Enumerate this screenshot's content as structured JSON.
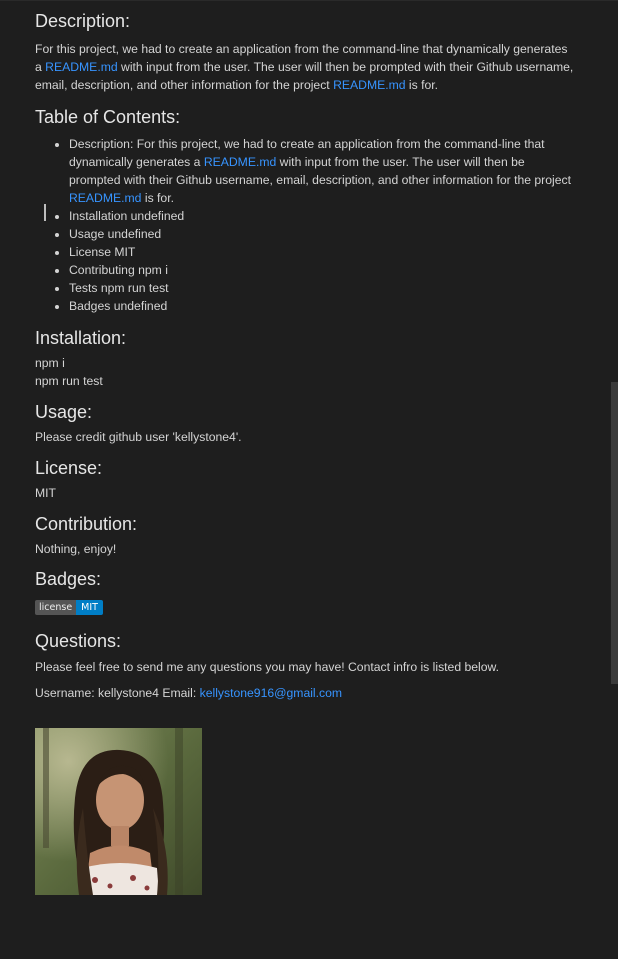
{
  "description": {
    "heading": "Description:",
    "text_before": "For this project, we had to create an application from the command-line that dynamically generates a ",
    "link1": "README.md",
    "text_middle": " with input from the user. The user will then be prompted with their Github username, email, description, and other information for the project ",
    "link2": "README.md",
    "text_after": " is for."
  },
  "toc": {
    "heading": "Table of Contents:",
    "desc_item": {
      "before": "Description: For this project, we had to create an application from the command-line that dynamically generates a ",
      "link1": "README.md",
      "middle": " with input from the user. The user will then be prompted with their Github username, email, description, and other information for the project ",
      "link2": "README.md",
      "after": " is for."
    },
    "items": [
      "Installation undefined",
      "Usage undefined",
      "License MIT",
      "Contributing npm i",
      "Tests npm run test",
      "Badges undefined"
    ]
  },
  "installation": {
    "heading": "Installation:",
    "line1": "npm i",
    "line2": "npm run test"
  },
  "usage": {
    "heading": "Usage:",
    "text": "Please credit github user 'kellystone4'."
  },
  "license": {
    "heading": "License:",
    "text": "MIT"
  },
  "contribution": {
    "heading": "Contribution:",
    "text": "Nothing, enjoy!"
  },
  "badges": {
    "heading": "Badges:",
    "badge_label": "license",
    "badge_value": "MIT",
    "badge_color": "#007ec6"
  },
  "questions": {
    "heading": "Questions:",
    "text": "Please feel free to send me any questions you may have! Contact infro is listed below.",
    "contact_prefix": "Username: kellystone4 Email: ",
    "email": "kellystone916@gmail.com"
  },
  "colors": {
    "background": "#1e1e1e",
    "link": "#3794ff",
    "text": "#d4d4d4"
  }
}
